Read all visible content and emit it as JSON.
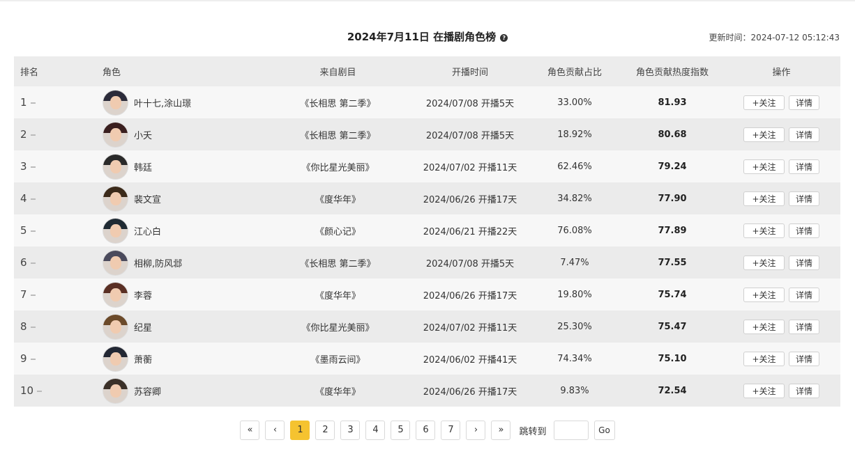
{
  "header": {
    "title": "2024年7月11日 在播剧角色榜",
    "help_icon": "?",
    "update_time": "更新时间：2024-07-12 05:12:43"
  },
  "table": {
    "columns": {
      "rank": "排名",
      "role": "角色",
      "drama": "来自剧目",
      "start": "开播时间",
      "share": "角色贡献占比",
      "heat": "角色贡献热度指数",
      "ops": "操作"
    },
    "follow_label": "+关注",
    "detail_label": "详情",
    "rows": [
      {
        "rank": "1",
        "name": "叶十七,涂山璟",
        "drama": "《长相思 第二季》",
        "start": "2024/07/08 开播5天",
        "share": "33.00%",
        "heat": "81.93"
      },
      {
        "rank": "2",
        "name": "小夭",
        "drama": "《长相思 第二季》",
        "start": "2024/07/08 开播5天",
        "share": "18.92%",
        "heat": "80.68"
      },
      {
        "rank": "3",
        "name": "韩廷",
        "drama": "《你比星光美丽》",
        "start": "2024/07/02 开播11天",
        "share": "62.46%",
        "heat": "79.24"
      },
      {
        "rank": "4",
        "name": "裴文宣",
        "drama": "《度华年》",
        "start": "2024/06/26 开播17天",
        "share": "34.82%",
        "heat": "77.90"
      },
      {
        "rank": "5",
        "name": "江心白",
        "drama": "《颜心记》",
        "start": "2024/06/21 开播22天",
        "share": "76.08%",
        "heat": "77.89"
      },
      {
        "rank": "6",
        "name": "相柳,防风邶",
        "drama": "《长相思 第二季》",
        "start": "2024/07/08 开播5天",
        "share": "7.47%",
        "heat": "77.55"
      },
      {
        "rank": "7",
        "name": "李蓉",
        "drama": "《度华年》",
        "start": "2024/06/26 开播17天",
        "share": "19.80%",
        "heat": "75.74"
      },
      {
        "rank": "8",
        "name": "纪星",
        "drama": "《你比星光美丽》",
        "start": "2024/07/02 开播11天",
        "share": "25.30%",
        "heat": "75.47"
      },
      {
        "rank": "9",
        "name": "萧蘅",
        "drama": "《墨雨云间》",
        "start": "2024/06/02 开播41天",
        "share": "74.34%",
        "heat": "75.10"
      },
      {
        "rank": "10",
        "name": "苏容卿",
        "drama": "《度华年》",
        "start": "2024/06/26 开播17天",
        "share": "9.83%",
        "heat": "72.54"
      }
    ]
  },
  "pagination": {
    "first": "«",
    "prev": "‹",
    "pages": [
      "1",
      "2",
      "3",
      "4",
      "5",
      "6",
      "7"
    ],
    "current": "1",
    "next": "›",
    "last": "»",
    "jump_label": "跳转到",
    "jump_value": "",
    "go_label": "Go"
  },
  "colors": {
    "accent": "#f5c330",
    "header_bg": "#ececec"
  }
}
